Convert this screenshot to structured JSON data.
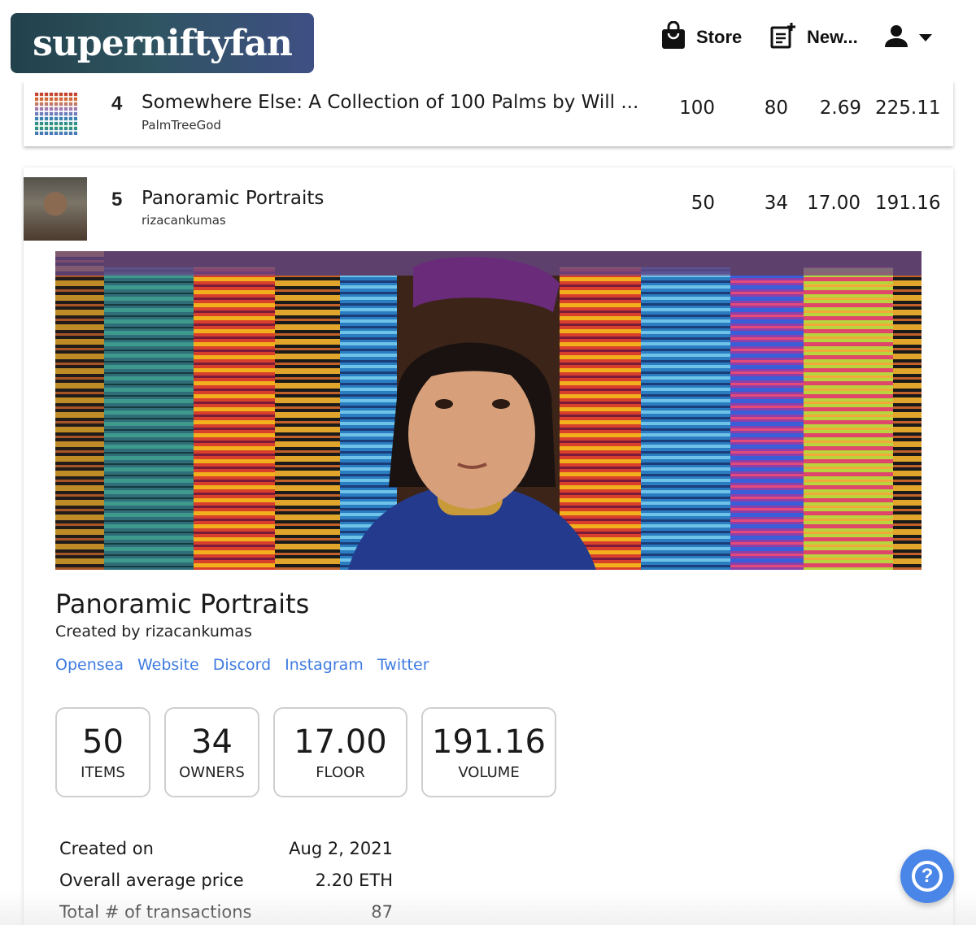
{
  "header": {
    "logo": "superniftyfan",
    "store_label": "Store",
    "new_label": "New..."
  },
  "rows": [
    {
      "rank": "4",
      "title": "Somewhere Else: A Collection of 100 Palms by Will ...",
      "creator": "PalmTreeGod",
      "items": "100",
      "owners": "80",
      "floor": "2.69",
      "volume": "225.11"
    },
    {
      "rank": "5",
      "title": "Panoramic Portraits",
      "creator": "rizacankumas",
      "items": "50",
      "owners": "34",
      "floor": "17.00",
      "volume": "191.16"
    }
  ],
  "detail": {
    "title": "Panoramic Portraits",
    "created_by": "Created by rizacankumas",
    "links": [
      "Opensea",
      "Website",
      "Discord",
      "Instagram",
      "Twitter"
    ],
    "stats": [
      {
        "value": "50",
        "label": "ITEMS"
      },
      {
        "value": "34",
        "label": "OWNERS"
      },
      {
        "value": "17.00",
        "label": "FLOOR"
      },
      {
        "value": "191.16",
        "label": "VOLUME"
      }
    ],
    "info": [
      {
        "label": "Created on",
        "value": "Aug 2, 2021"
      },
      {
        "label": "Overall average price",
        "value": "2.20 ETH"
      },
      {
        "label": "Total # of transactions",
        "value": "87"
      }
    ]
  },
  "help_label": "?",
  "colors": {
    "link": "#3f7be0",
    "help_button": "#4a86e8",
    "logo_gradient_start": "#22414c",
    "logo_gradient_end": "#3f4f84"
  }
}
